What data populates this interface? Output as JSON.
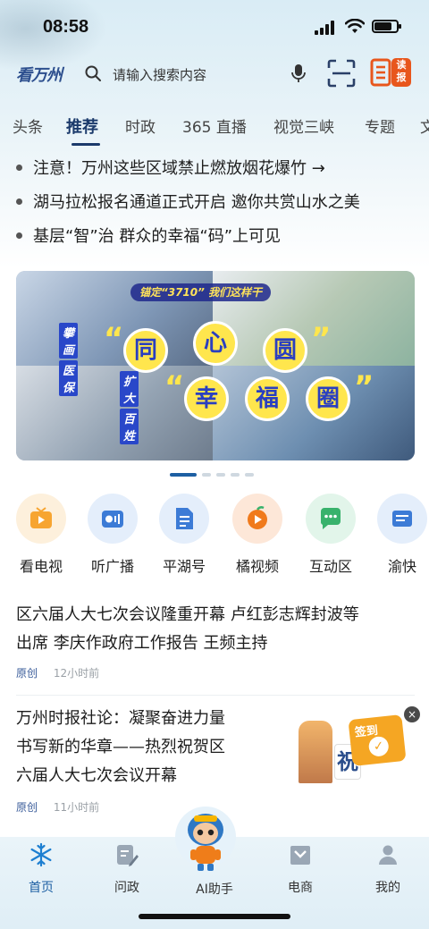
{
  "status_bar": {
    "time": "08:58",
    "battery_level": 0.8
  },
  "header": {
    "logo_text": "看万州",
    "search_placeholder": "请输入搜索内容",
    "read_badge": "读报"
  },
  "tabs": [
    {
      "label": "头条",
      "active": false
    },
    {
      "label": "推荐",
      "active": true
    },
    {
      "label": "时政",
      "active": false
    },
    {
      "label": "365 直播",
      "active": false
    },
    {
      "label": "视觉三峡",
      "active": false
    },
    {
      "label": "专题",
      "active": false
    },
    {
      "label": "文",
      "active": false
    }
  ],
  "headlines": [
    "注意！万州这些区域禁止燃放烟花爆竹 →",
    "湖马拉松报名通道正式开启 邀你共赏山水之美",
    "基层“智”治  群众的幸福“码”上可见"
  ],
  "banner": {
    "tag": "锚定“3710” 我们这样干",
    "line1_small": [
      "攀画",
      "医保"
    ],
    "line1_chars": [
      "同",
      "心",
      "圆"
    ],
    "line2_small": [
      "扩大",
      "百姓"
    ],
    "line2_chars": [
      "幸",
      "福",
      "圈"
    ],
    "page_count": 5,
    "active_page": 1
  },
  "quick_links": [
    {
      "label": "看电视",
      "icon": "tv-icon",
      "color": "#f7a531",
      "bg": "#fdf0dc"
    },
    {
      "label": "听广播",
      "icon": "radio-icon",
      "color": "#3c7bd6",
      "bg": "#e4eefb"
    },
    {
      "label": "平湖号",
      "icon": "document-icon",
      "color": "#3c7bd6",
      "bg": "#e4eefb"
    },
    {
      "label": "橘视频",
      "icon": "orange-play-icon",
      "color": "#f07a1c",
      "bg": "#fde7d8"
    },
    {
      "label": "互动区",
      "icon": "chat-icon",
      "color": "#38b26c",
      "bg": "#e2f5ea"
    },
    {
      "label": "渝快",
      "icon": "service-icon",
      "color": "#3c7bd6",
      "bg": "#e4eefb"
    }
  ],
  "articles": [
    {
      "title_lines": [
        "区六届人大七次会议隆重开幕 卢红彭志辉封波等",
        "出席 李庆作政府工作报告 王频主持"
      ],
      "source": "原创",
      "time": "12小时前"
    },
    {
      "title_lines": [
        "万州时报社论：凝聚奋进力量",
        "书写新的华章——热烈祝贺区",
        "六届人大七次会议开幕"
      ],
      "source": "原创",
      "time": "11小时前"
    }
  ],
  "signin_widget": {
    "label": "签到",
    "close": "×",
    "bubble_char": "祝"
  },
  "bottom_nav": [
    {
      "label": "首页",
      "icon": "snowflake-icon",
      "active": true
    },
    {
      "label": "问政",
      "icon": "edit-icon",
      "active": false
    },
    {
      "label": "AI助手",
      "icon": "robot-mascot-icon",
      "active": false
    },
    {
      "label": "电商",
      "icon": "shop-icon",
      "active": false
    },
    {
      "label": "我的",
      "icon": "user-icon",
      "active": false
    }
  ],
  "colors": {
    "accent": "#1b3a6b",
    "brand_blue": "#2d4f8e",
    "read_badge": "#e8561c"
  }
}
